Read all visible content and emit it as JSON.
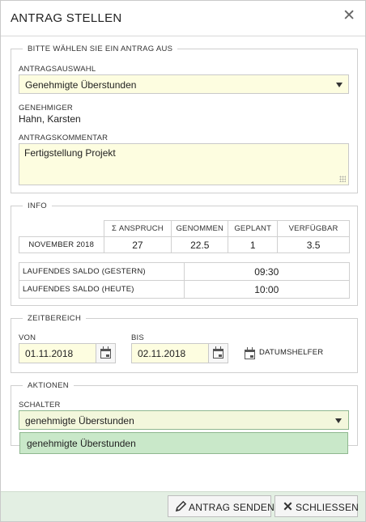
{
  "dialog": {
    "title": "ANTRAG STELLEN",
    "close_symbol": "✕"
  },
  "section_select": {
    "legend": "BITTE WÄHLEN SIE EIN ANTRAG AUS",
    "selection_label": "ANTRAGSAUSWAHL",
    "selection_value": "Genehmigte Überstunden",
    "approver_label": "GENEHMIGER",
    "approver_value": "Hahn, Karsten",
    "comment_label": "ANTRAGSKOMMENTAR",
    "comment_value": "Fertigstellung Projekt"
  },
  "section_info": {
    "legend": "INFO",
    "columns": [
      "Σ ANSPRUCH",
      "GENOMMEN",
      "GEPLANT",
      "VERFÜGBAR"
    ],
    "row_label": "NOVEMBER 2018",
    "row_values": [
      "27",
      "22.5",
      "1",
      "3.5"
    ],
    "saldo": [
      {
        "label": "LAUFENDES SALDO (GESTERN)",
        "value": "09:30"
      },
      {
        "label": "LAUFENDES SALDO (HEUTE)",
        "value": "10:00"
      }
    ]
  },
  "section_time": {
    "legend": "ZEITBEREICH",
    "from_label": "VON",
    "from_value": "01.11.2018",
    "to_label": "BIS",
    "to_value": "02.11.2018",
    "helper_label": "DATUMSHELFER"
  },
  "section_actions": {
    "legend": "AKTIONEN",
    "switch_label": "SCHALTER",
    "switch_value": "genehmigte Überstunden",
    "dropdown_option": "genehmigte Überstunden"
  },
  "footer": {
    "send_label": "ANTRAG SENDEN",
    "close_label": "SCHLIESSEN"
  },
  "colors": {
    "input_bg": "#fdfde0",
    "footer_bg": "#e3efe3",
    "dropdown_highlight": "#c9e8c9"
  },
  "icons": {
    "send": "pencil-icon",
    "close": "x-icon",
    "calendar": "calendar-icon",
    "helper": "calendar-plus-icon"
  }
}
